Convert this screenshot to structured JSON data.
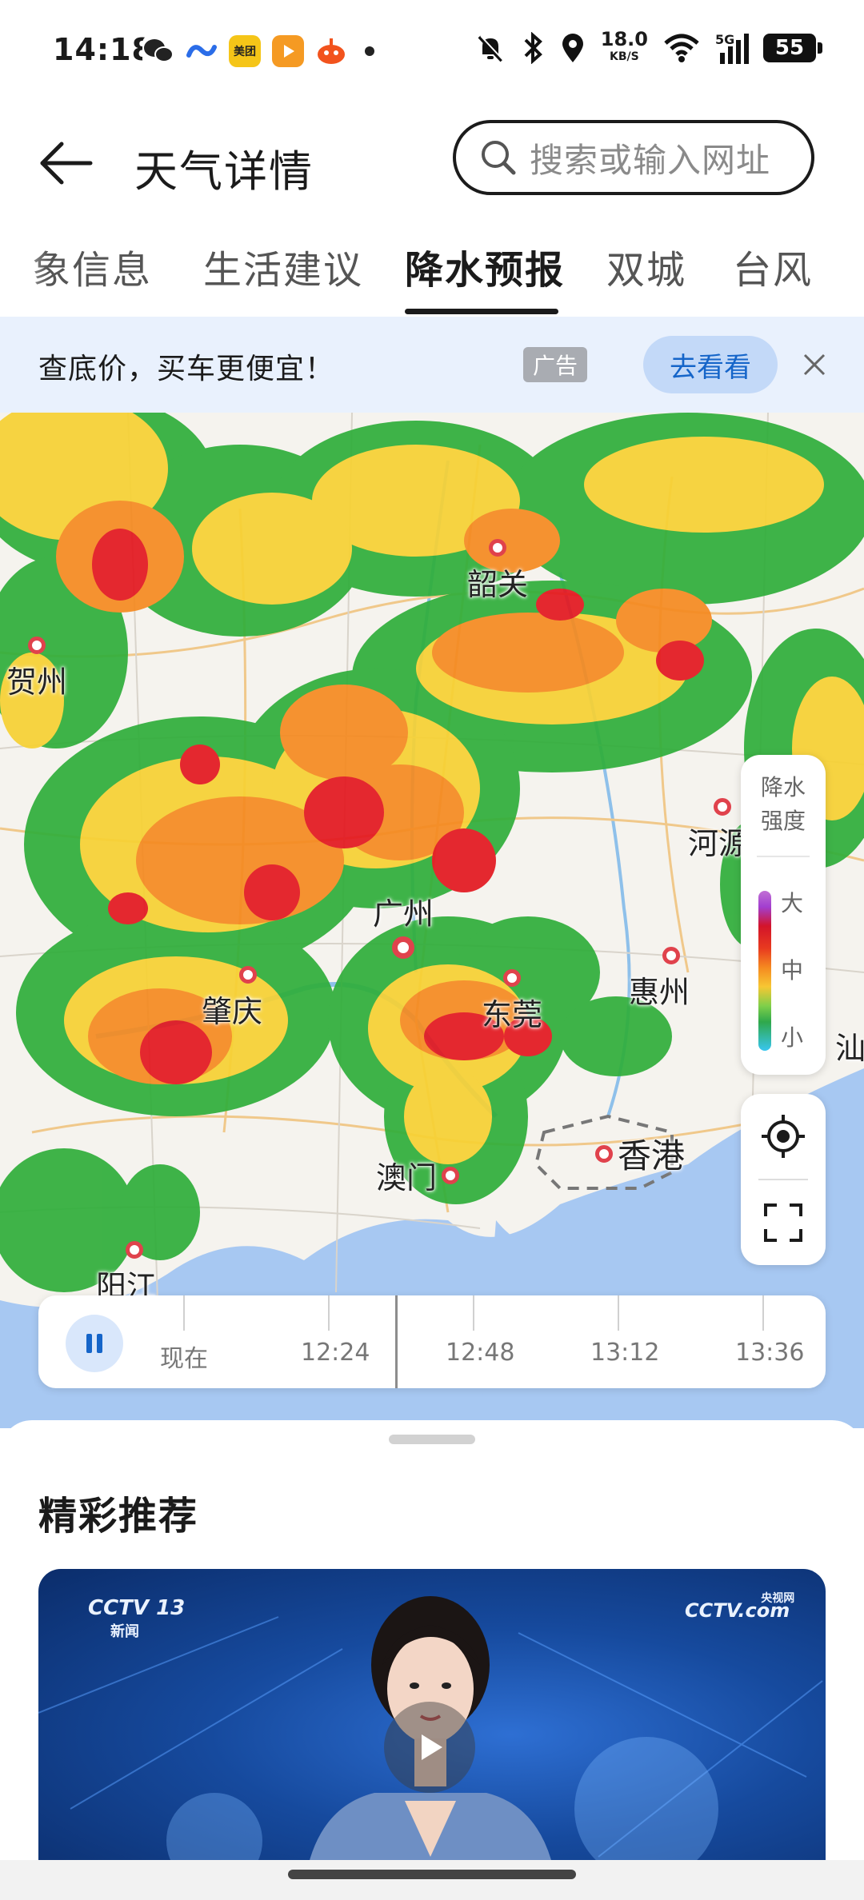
{
  "status_bar": {
    "time": "14:18",
    "apps": [
      "wechat",
      "baidu",
      "美团",
      "video",
      "taobao"
    ],
    "net_speed_value": "18.0",
    "net_speed_unit": "KB/S",
    "network": "5G",
    "battery": "55"
  },
  "header": {
    "title": "天气详情",
    "search_placeholder": "搜索或输入网址"
  },
  "tabs": [
    {
      "label": "象信息",
      "active": false
    },
    {
      "label": "生活建议",
      "active": false
    },
    {
      "label": "降水预报",
      "active": true
    },
    {
      "label": "双城",
      "active": false
    },
    {
      "label": "台风",
      "active": false
    }
  ],
  "ad": {
    "text": "查底价，买车更便宜！",
    "tag": "广告",
    "button": "去看看"
  },
  "map": {
    "cities": [
      "韶关",
      "贺州",
      "河源",
      "广州",
      "肇庆",
      "东莞",
      "惠州",
      "汕",
      "澳门",
      "香港",
      "阳江"
    ],
    "legend": {
      "title_line1": "降水",
      "title_line2": "强度",
      "high": "大",
      "mid": "中",
      "low": "小"
    },
    "timeline": {
      "labels": [
        "现在",
        "12:24",
        "12:48",
        "13:12",
        "13:36"
      ]
    }
  },
  "recommend": {
    "title": "精彩推荐",
    "video_logo_left": "CCTV 13",
    "video_logo_left_sub": "新闻",
    "video_logo_right": "CCTV.com",
    "video_logo_right_sub": "央视网"
  },
  "colors": {
    "accent": "#1565c9",
    "ad_bg": "#e9f1fd",
    "rain_heavy": "#e3171f",
    "rain_mid": "#f7b733",
    "rain_light": "#2fa84b"
  }
}
